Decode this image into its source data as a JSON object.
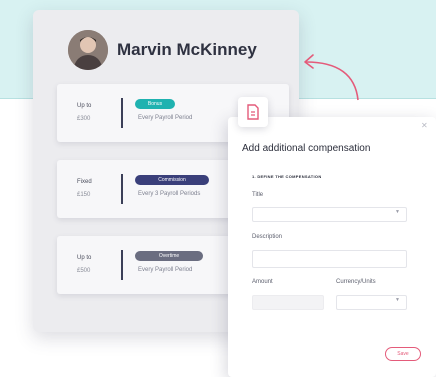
{
  "profile": {
    "name": "Marvin McKinney",
    "rows": [
      {
        "line1": "Up to",
        "line2": "£300",
        "badge": "Bonus",
        "badge_color": "#1fb2b0",
        "period": "Every Payroll Period"
      },
      {
        "line1": "Fixed",
        "line2": "£150",
        "badge": "Commission",
        "badge_color": "#3a3f7a",
        "period": "Every 3 Payroll Periods"
      },
      {
        "line1": "Up to",
        "line2": "£500",
        "badge": "Overtime",
        "badge_color": "#6a6d80",
        "period": "Every Payroll Period"
      }
    ]
  },
  "modal": {
    "title": "Add additional compensation",
    "section": "1. DEFINE THE COMPENSATION",
    "type_label": "Title",
    "description_label": "Description",
    "amount_label": "Amount",
    "currency_label": "Currency/Units",
    "save_label": "Save"
  },
  "colors": {
    "accent": "#e45b7a",
    "band": "#d8f2f2"
  }
}
